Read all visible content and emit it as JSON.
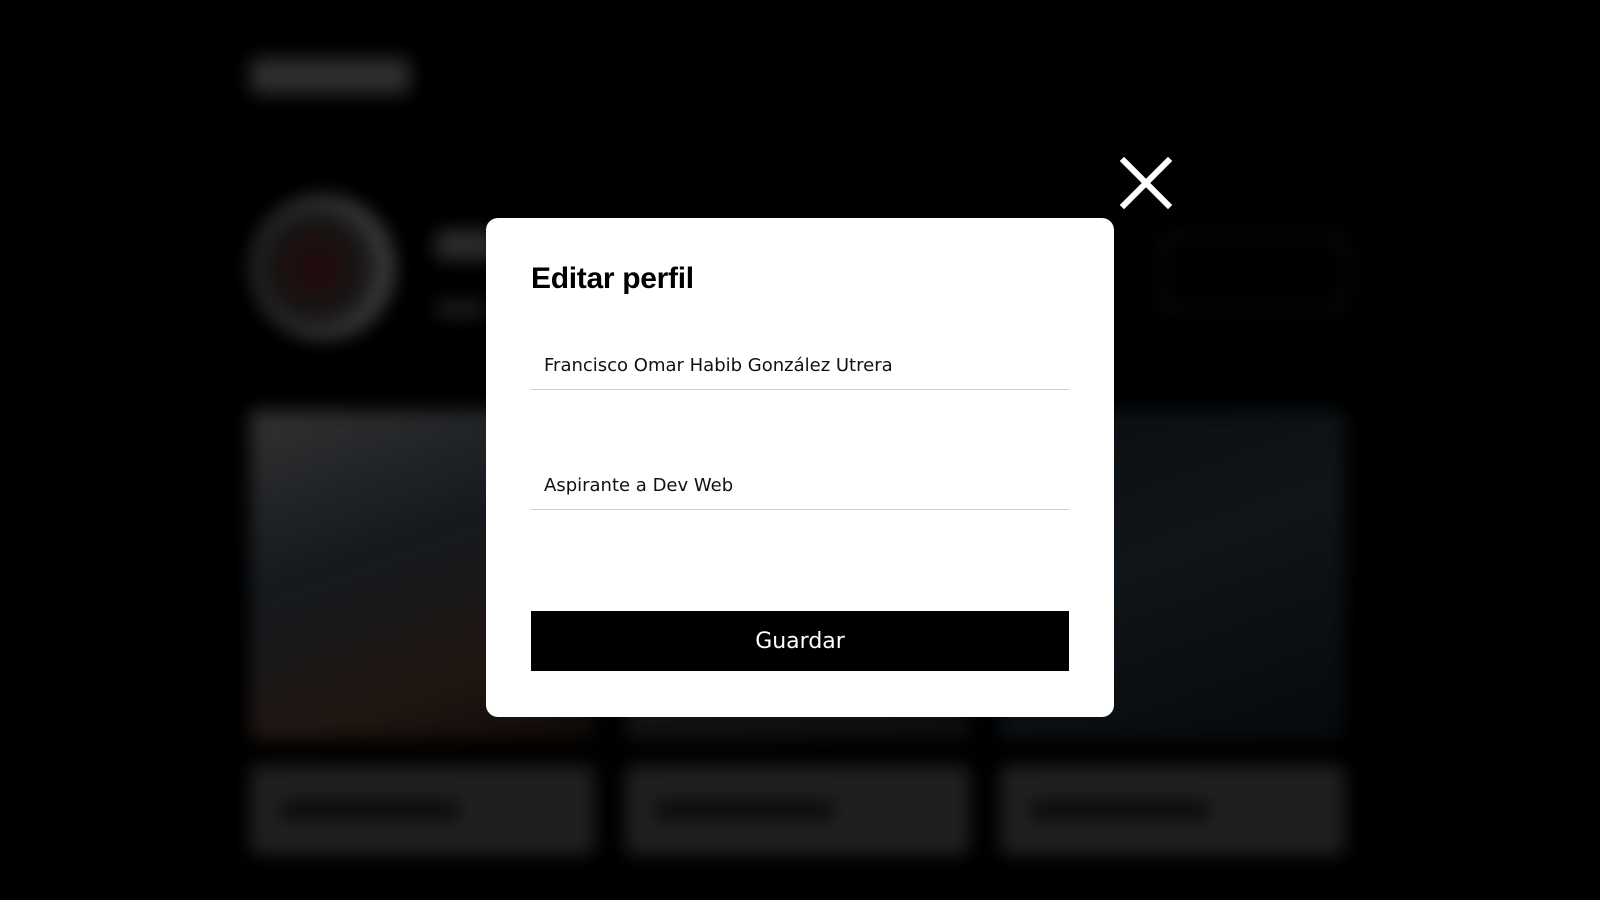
{
  "modal": {
    "title": "Editar perfil",
    "name_value": "Francisco Omar Habib González Utrera",
    "bio_value": "Aspirante a Dev Web",
    "save_label": "Guardar"
  },
  "icons": {
    "close": "close-icon"
  },
  "colors": {
    "backdrop": "#000000",
    "modal_bg": "#ffffff",
    "button_bg": "#000000",
    "button_text": "#ffffff"
  }
}
